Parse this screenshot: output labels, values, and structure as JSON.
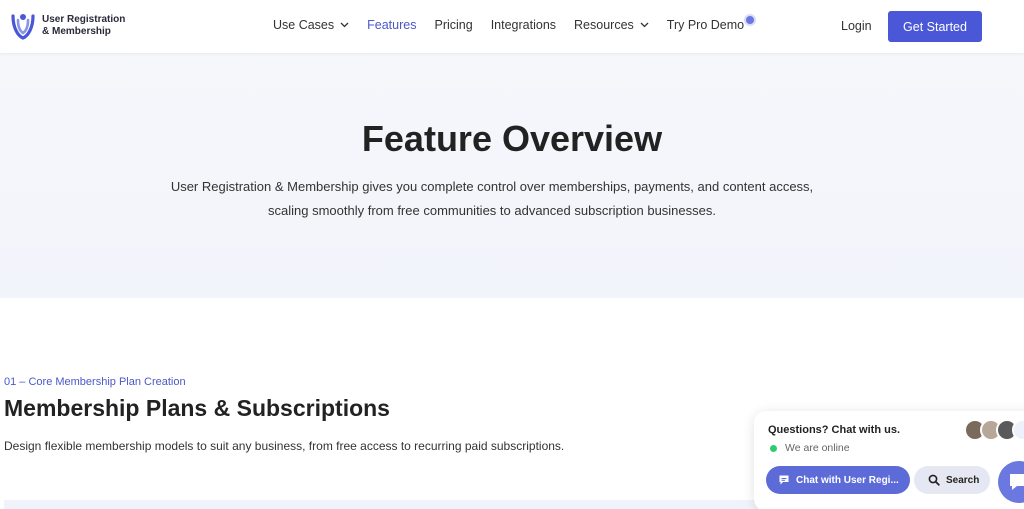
{
  "brand": {
    "line1": "User Registration",
    "line2": "& Membership",
    "color": "#4a58d8"
  },
  "nav": {
    "items": [
      {
        "label": "Use Cases",
        "has_dropdown": true,
        "active": false
      },
      {
        "label": "Features",
        "has_dropdown": false,
        "active": true
      },
      {
        "label": "Pricing",
        "has_dropdown": false,
        "active": false
      },
      {
        "label": "Integrations",
        "has_dropdown": false,
        "active": false
      },
      {
        "label": "Resources",
        "has_dropdown": true,
        "active": false
      },
      {
        "label": "Try Pro Demo",
        "has_dropdown": false,
        "active": false
      }
    ],
    "login": "Login",
    "cta": "Get Started"
  },
  "hero": {
    "title": "Feature Overview",
    "description_line1": "User Registration & Membership gives you complete control over memberships, payments, and content access,",
    "description_line2": "scaling smoothly from free communities to advanced subscription businesses."
  },
  "section": {
    "eyebrow": "01 – Core Membership Plan Creation",
    "title": "Membership Plans & Subscriptions",
    "description": "Design flexible membership models to suit any business, from free access to recurring paid subscriptions."
  },
  "chat": {
    "question": "Questions? Chat with us.",
    "status": "We are online",
    "chat_button": "Chat with User Regi...",
    "search_button": "Search",
    "status_color": "#2ecc71",
    "icons": [
      "chat-bubble-icon",
      "search-icon",
      "chat-launcher-icon"
    ]
  }
}
